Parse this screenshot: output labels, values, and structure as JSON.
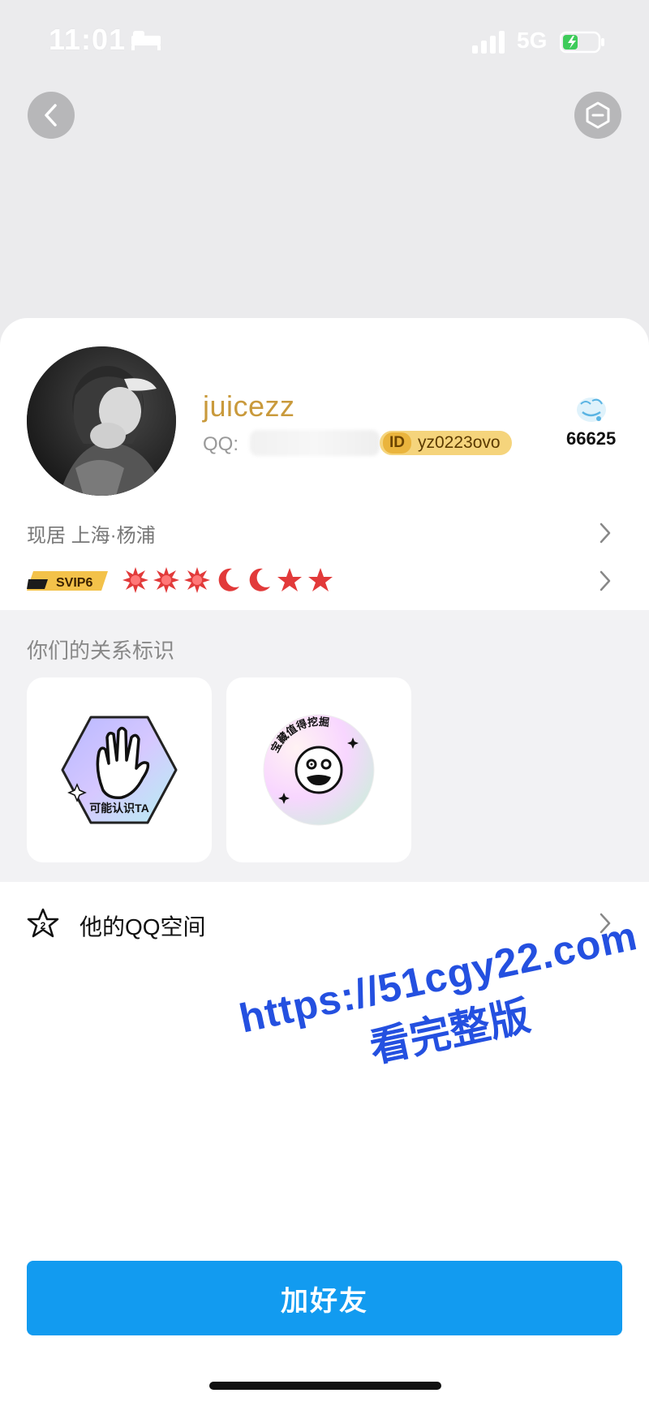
{
  "status_bar": {
    "time": "11:01",
    "network": "5G"
  },
  "profile": {
    "nickname": "juicezz",
    "qq_label": "QQ:",
    "id_tag": "ID",
    "id_value": "yz0223ovo",
    "like_count": "66625",
    "location": "现居 上海·杨浦",
    "vip_label": "SVIP6"
  },
  "relation": {
    "title": "你们的关系标识",
    "badge1_text": "可能认识TA",
    "badge2_text": "宝藏值得挖掘"
  },
  "qzone": {
    "label": "他的QQ空间",
    "icon_number": "2"
  },
  "watermark": {
    "url": "https://51cgy22.com",
    "text": "看完整版"
  },
  "actions": {
    "add_friend": "加好友"
  },
  "colors": {
    "primary": "#129bf0",
    "nickname": "#c99a3c",
    "id_badge": "#f5d47c"
  }
}
